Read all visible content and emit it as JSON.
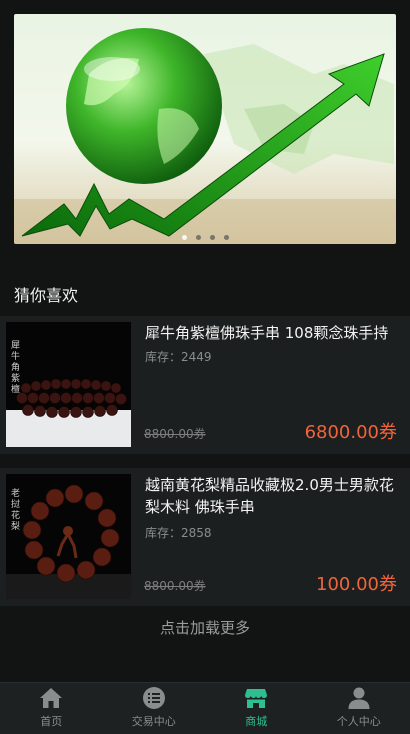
{
  "banner": {
    "slides": 4,
    "active_slide": 0
  },
  "section": {
    "title": "猜你喜欢"
  },
  "products": [
    {
      "title": "犀牛角紫檀佛珠手串 108颗念珠手持",
      "stock": "库存：2449",
      "old_price": "8800.00券",
      "price": "6800.00券",
      "thumb_text": "犀牛角紫檀"
    },
    {
      "title": "越南黄花梨精品收藏极2.0男士男款花梨木料 佛珠手串",
      "stock": "库存：2858",
      "old_price": "8800.00券",
      "price": "100.00券",
      "thumb_text": "老挝花梨"
    }
  ],
  "load_more": "点击加载更多",
  "tabbar": {
    "items": [
      {
        "label": "首页",
        "icon": "home-icon"
      },
      {
        "label": "交易中心",
        "icon": "list-icon"
      },
      {
        "label": "商城",
        "icon": "shop-icon",
        "active": true
      },
      {
        "label": "个人中心",
        "icon": "user-icon"
      }
    ],
    "active_color": "#2fbf8e",
    "inactive_color": "#8a8d8d"
  },
  "colors": {
    "background": "#121414",
    "card": "#1c1f1f",
    "price": "#f0643c"
  }
}
